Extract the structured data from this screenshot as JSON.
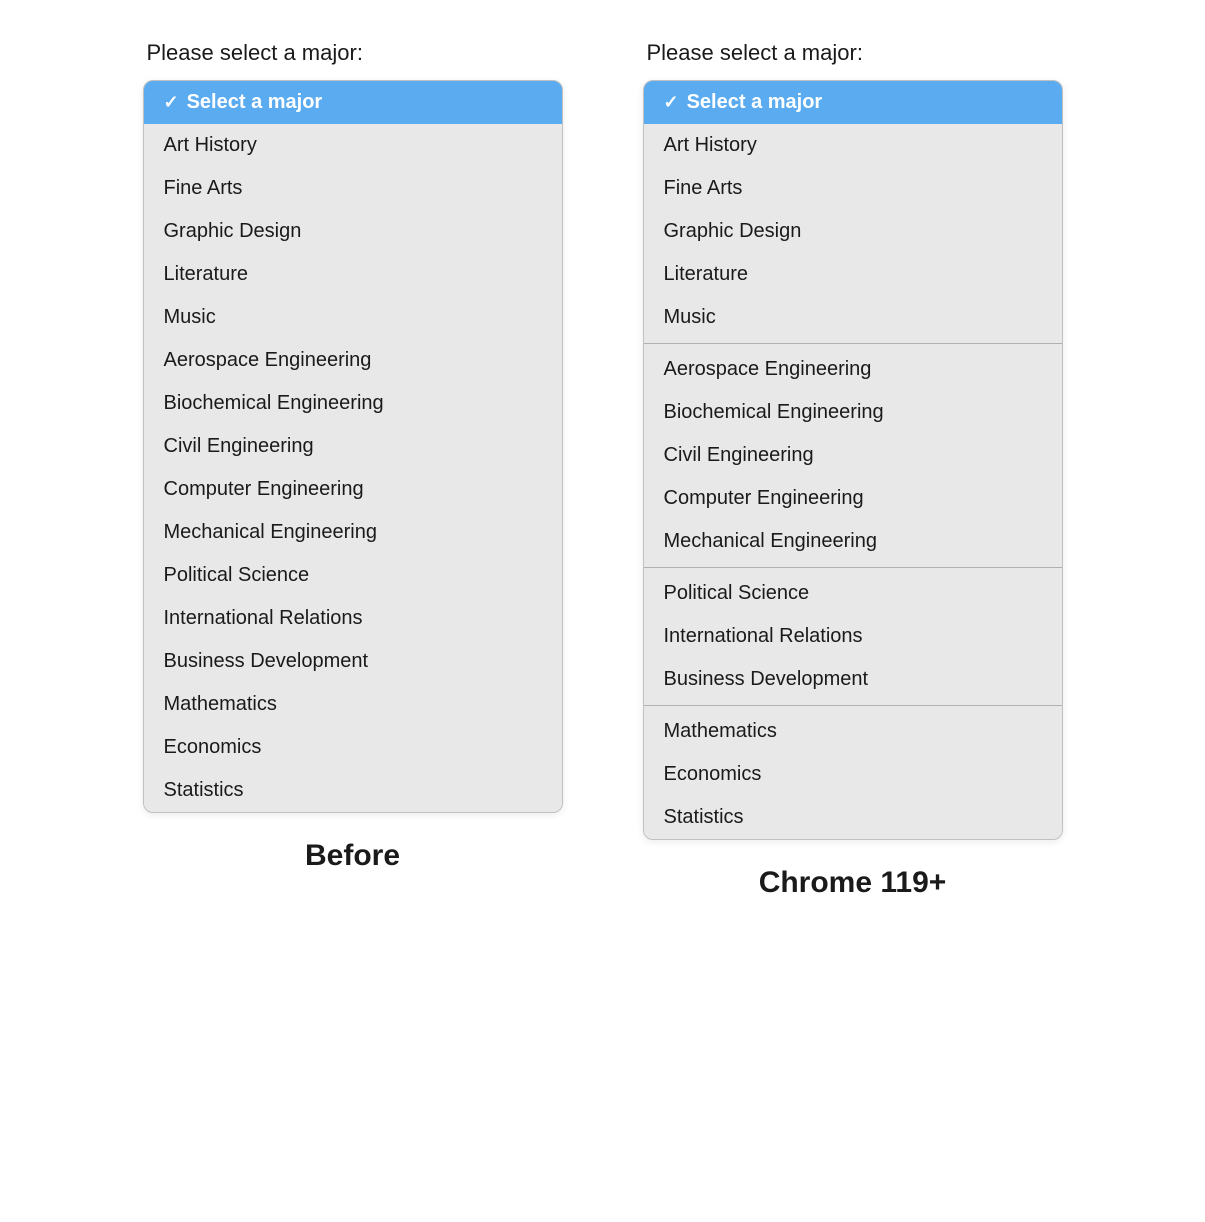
{
  "page": {
    "before_label": "Before",
    "after_label": "Chrome 119+",
    "prompt": "Please select a major:"
  },
  "select_placeholder": "Select a major",
  "majors": {
    "arts": [
      "Art History",
      "Fine Arts",
      "Graphic Design",
      "Literature",
      "Music"
    ],
    "engineering": [
      "Aerospace Engineering",
      "Biochemical Engineering",
      "Civil Engineering",
      "Computer Engineering",
      "Mechanical Engineering"
    ],
    "social_sciences": [
      "Political Science",
      "International Relations",
      "Business Development"
    ],
    "math": [
      "Mathematics",
      "Economics",
      "Statistics"
    ]
  },
  "colors": {
    "selected_bg": "#5aabf0",
    "item_bg": "#e8e8e8"
  }
}
